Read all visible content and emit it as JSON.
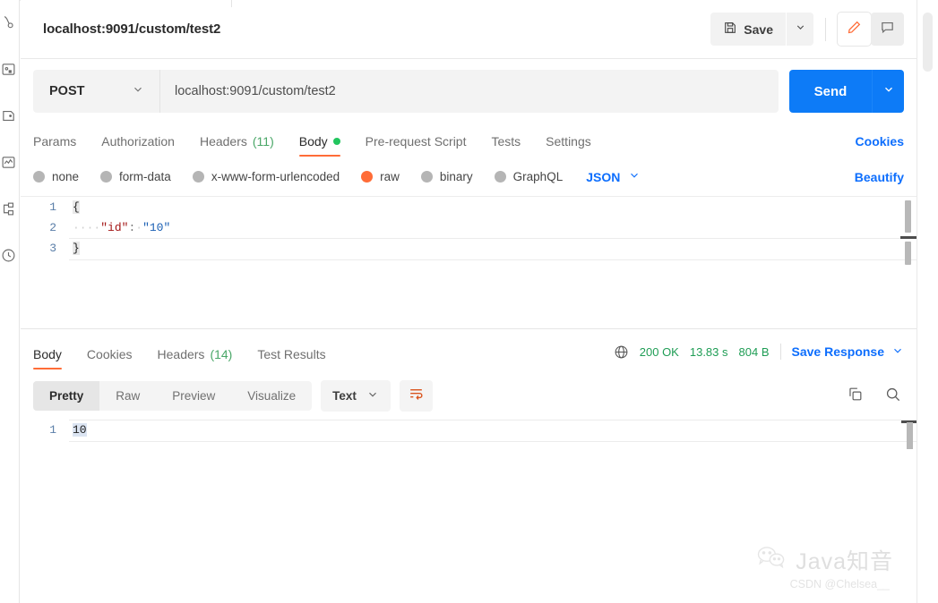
{
  "window": {
    "request_title": "localhost:9091/custom/test2"
  },
  "header": {
    "save_label": "Save",
    "save_icon": "floppy-disk-icon",
    "save_caret_icon": "chevron-down-icon",
    "edit_icon": "pencil-icon",
    "comment_icon": "comment-icon"
  },
  "request": {
    "method": "POST",
    "method_caret_icon": "chevron-down-icon",
    "url": "localhost:9091/custom/test2",
    "send_label": "Send",
    "send_caret_icon": "chevron-down-icon"
  },
  "request_tabs": {
    "items": [
      {
        "label": "Params",
        "count": "",
        "active": false,
        "dot": false
      },
      {
        "label": "Authorization",
        "count": "",
        "active": false,
        "dot": false
      },
      {
        "label": "Headers",
        "count": "(11)",
        "active": false,
        "dot": false
      },
      {
        "label": "Body",
        "count": "",
        "active": true,
        "dot": true
      },
      {
        "label": "Pre-request Script",
        "count": "",
        "active": false,
        "dot": false
      },
      {
        "label": "Tests",
        "count": "",
        "active": false,
        "dot": false
      },
      {
        "label": "Settings",
        "count": "",
        "active": false,
        "dot": false
      }
    ],
    "cookies_label": "Cookies"
  },
  "body_options": {
    "radios": [
      {
        "label": "none",
        "selected": false
      },
      {
        "label": "form-data",
        "selected": false
      },
      {
        "label": "x-www-form-urlencoded",
        "selected": false
      },
      {
        "label": "raw",
        "selected": true
      },
      {
        "label": "binary",
        "selected": false
      },
      {
        "label": "GraphQL",
        "selected": false
      }
    ],
    "format": "JSON",
    "format_caret_icon": "chevron-down-icon",
    "beautify_label": "Beautify"
  },
  "request_body": {
    "language": "json",
    "lines": [
      {
        "no": "1",
        "open_brace": "{"
      },
      {
        "no": "2",
        "indent": "····",
        "key": "\"id\"",
        "colon": ":",
        "space": "·",
        "value": "\"10\""
      },
      {
        "no": "3",
        "close_brace": "}"
      }
    ]
  },
  "response_tabs": {
    "items": [
      {
        "label": "Body",
        "count": "",
        "active": true
      },
      {
        "label": "Cookies",
        "count": "",
        "active": false
      },
      {
        "label": "Headers",
        "count": "(14)",
        "active": false
      },
      {
        "label": "Test Results",
        "count": "",
        "active": false
      }
    ]
  },
  "response_meta": {
    "globe_icon": "globe-icon",
    "status": "200 OK",
    "time": "13.83 s",
    "size": "804 B",
    "save_response_label": "Save Response",
    "save_response_caret_icon": "chevron-down-icon"
  },
  "response_toolbar": {
    "views": [
      {
        "label": "Pretty",
        "active": true
      },
      {
        "label": "Raw",
        "active": false
      },
      {
        "label": "Preview",
        "active": false
      },
      {
        "label": "Visualize",
        "active": false
      }
    ],
    "format": "Text",
    "format_caret_icon": "chevron-down-icon",
    "wrap_icon": "word-wrap-icon",
    "copy_icon": "copy-icon",
    "search_icon": "search-icon"
  },
  "response_body": {
    "lines": [
      {
        "no": "1",
        "text": "10"
      }
    ]
  },
  "watermark": {
    "wechat_icon": "wechat-icon",
    "brand": "Java知音",
    "credit": "CSDN @Chelsea__"
  },
  "sidebar": {
    "icons": [
      "collections-icon",
      "apis-icon",
      "environments-icon",
      "mock-icon",
      "monitors-icon",
      "flows-icon",
      "history-icon"
    ]
  },
  "colors": {
    "accent_orange": "#ff6c37",
    "primary_blue": "#0d7bf7",
    "success_green": "#1f9d55"
  }
}
